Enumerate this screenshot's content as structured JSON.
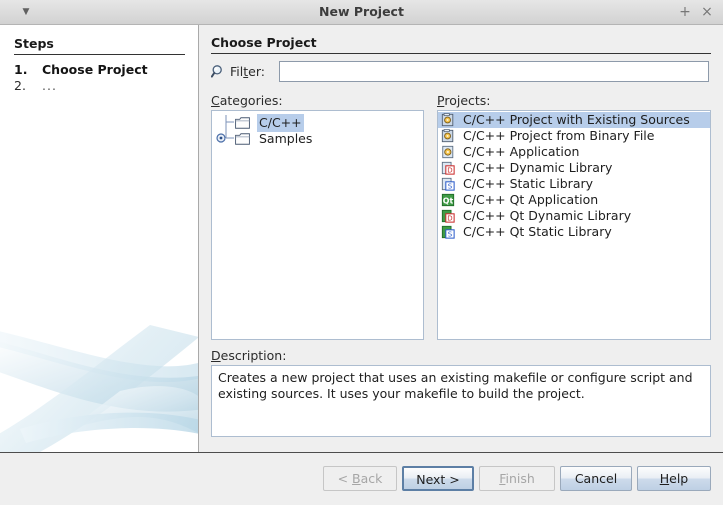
{
  "window": {
    "title": "New Project",
    "menu_icon": "caret-down-icon",
    "maximize_icon": "+",
    "close_icon": "×"
  },
  "steps": {
    "heading": "Steps",
    "items": [
      {
        "number": "1.",
        "label": "Choose Project",
        "current": true
      },
      {
        "number": "2.",
        "label": "...",
        "current": false
      }
    ]
  },
  "main": {
    "title": "Choose Project",
    "filter": {
      "label_pre": "Fil",
      "label_mn": "t",
      "label_post": "er:",
      "value": "",
      "placeholder": "",
      "icon": "search-icon"
    },
    "categories": {
      "label_mn": "C",
      "label_post": "ategories:",
      "items": [
        {
          "label": "C/C++",
          "selected": true,
          "expandable": false
        },
        {
          "label": "Samples",
          "selected": false,
          "expandable": true
        }
      ]
    },
    "projects": {
      "label_mn": "P",
      "label_post": "rojects:",
      "items": [
        {
          "label": "C/C++ Project with Existing Sources",
          "icon": "project-existing-sources-icon",
          "selected": true
        },
        {
          "label": "C/C++ Project from Binary File",
          "icon": "project-binary-file-icon",
          "selected": false
        },
        {
          "label": "C/C++ Application",
          "icon": "application-icon",
          "selected": false
        },
        {
          "label": "C/C++ Dynamic Library",
          "icon": "dynamic-library-icon",
          "selected": false
        },
        {
          "label": "C/C++ Static Library",
          "icon": "static-library-icon",
          "selected": false
        },
        {
          "label": "C/C++ Qt Application",
          "icon": "qt-application-icon",
          "selected": false
        },
        {
          "label": "C/C++ Qt Dynamic Library",
          "icon": "qt-dynamic-library-icon",
          "selected": false
        },
        {
          "label": "C/C++ Qt Static Library",
          "icon": "qt-static-library-icon",
          "selected": false
        }
      ]
    },
    "description": {
      "label_mn": "D",
      "label_post": "escription:",
      "text": "Creates a new project that uses an existing makefile or configure script and existing sources. It uses your makefile to build the project."
    }
  },
  "buttons": {
    "back": {
      "pre": "< ",
      "mn": "B",
      "post": "ack",
      "enabled": false,
      "default": false
    },
    "next": {
      "pre": "",
      "mn": "N",
      "post": "ext >",
      "enabled": true,
      "default": true
    },
    "finish": {
      "pre": "",
      "mn": "F",
      "post": "inish",
      "enabled": false,
      "default": false
    },
    "cancel": {
      "pre": "",
      "mn": "C",
      "post": "ancel",
      "enabled": true,
      "default": false
    },
    "help": {
      "pre": "",
      "mn": "H",
      "post": "elp",
      "enabled": true,
      "default": false
    }
  },
  "colors": {
    "selection": "#b7cdea",
    "window_bg": "#efefef",
    "panel_bg": "#ffffff",
    "field_border": "#8d9aaa"
  }
}
